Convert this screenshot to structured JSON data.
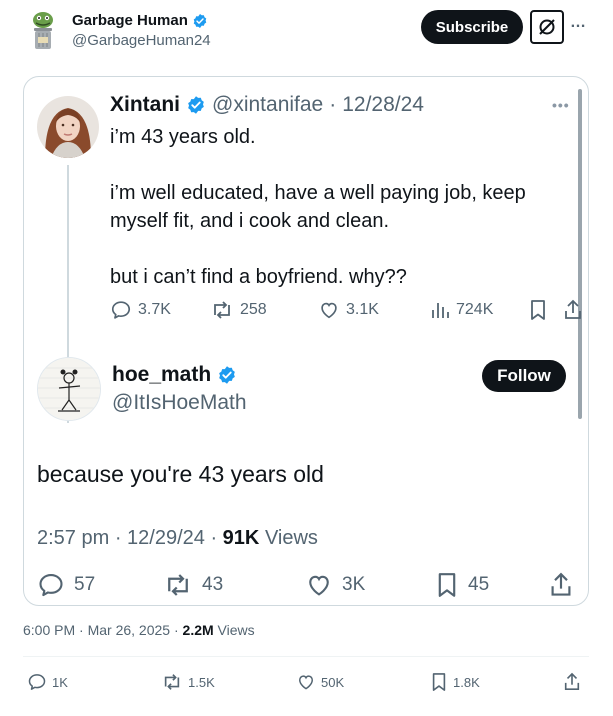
{
  "post": {
    "author_name": "Garbage Human",
    "author_handle": "@GarbageHuman24",
    "subscribe_label": "Subscribe",
    "more_icon": "…",
    "timestamp": "6:00 PM · Mar 26, 2025 ·",
    "views_count": "2.2M",
    "views_label": "Views",
    "actions": {
      "replies": "1K",
      "reposts": "1.5K",
      "likes": "50K",
      "bookmarks": "1.8K"
    }
  },
  "quote": {
    "original": {
      "name": "Xintani",
      "handle": "@xintanifae",
      "separator": "·",
      "date": "12/28/24",
      "more_icon": "•••",
      "paragraphs": [
        "i’m 43 years old.",
        "i’m well educated, have a well paying job, keep myself fit, and i cook and clean.",
        "but i can’t find a boyfriend. why??"
      ],
      "actions": {
        "replies": "3.7K",
        "reposts": "258",
        "likes": "3.1K",
        "views": "724K"
      }
    },
    "reply": {
      "name": "hoe_math",
      "handle": "@ItIsHoeMath",
      "follow_label": "Follow",
      "text": "because you're 43 years old",
      "time_date": "2:57 pm · 12/29/24 ·",
      "views_count": "91K",
      "views_label": "Views",
      "actions": {
        "replies": "57",
        "reposts": "43",
        "likes": "3K",
        "bookmarks": "45"
      }
    }
  },
  "colors": {
    "text_primary": "#0f1419",
    "text_secondary": "#536471",
    "verified_blue": "#1d9bf0",
    "border": "#cfd9de",
    "button_dark": "#0f1419"
  }
}
